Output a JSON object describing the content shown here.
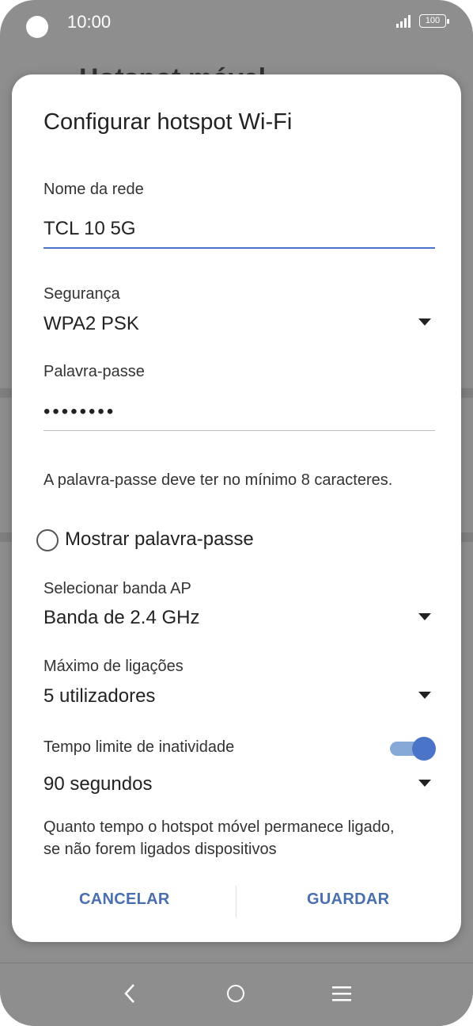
{
  "status_bar": {
    "time": "10:00",
    "battery": "100"
  },
  "background_app": {
    "title": "Hotspot móvel"
  },
  "dialog": {
    "title": "Configurar hotspot Wi-Fi",
    "network_name": {
      "label": "Nome da rede",
      "value": "TCL 10 5G"
    },
    "security": {
      "label": "Segurança",
      "value": "WPA2 PSK"
    },
    "password": {
      "label": "Palavra-passe",
      "value": "••••••••",
      "hint": "A palavra-passe deve ter no mínimo 8 caracteres."
    },
    "show_password": {
      "label": "Mostrar palavra-passe",
      "checked": false
    },
    "ap_band": {
      "label": "Selecionar banda AP",
      "value": "Banda de 2.4 GHz"
    },
    "max_connections": {
      "label": "Máximo de ligações",
      "value": "5 utilizadores"
    },
    "timeout": {
      "label": "Tempo limite de inatividade",
      "toggle_on": true,
      "value": "90 segundos",
      "hint": "Quanto tempo o hotspot móvel permanece ligado, se não forem ligados dispositivos"
    },
    "cancel_label": "CANCELAR",
    "save_label": "GUARDAR"
  },
  "colors": {
    "accent": "#4a74c7",
    "button_text": "#4a6fb0",
    "scrim": "#8e8e8e"
  }
}
